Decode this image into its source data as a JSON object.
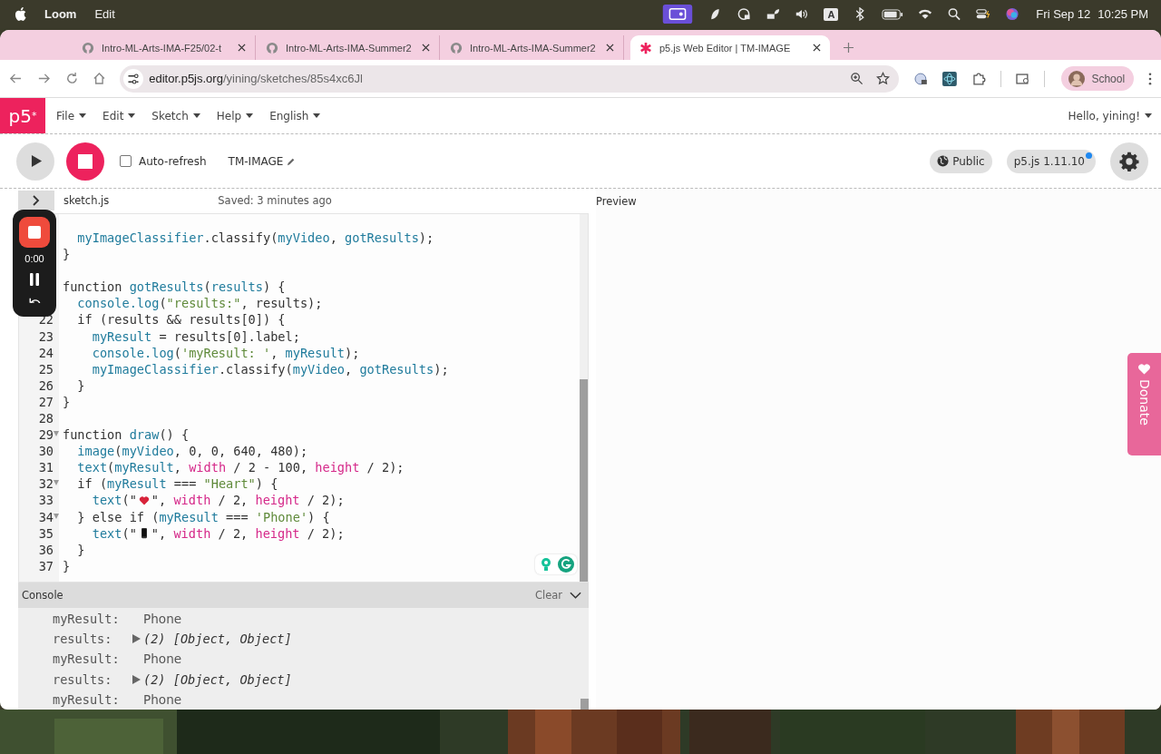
{
  "menubar": {
    "app": "Loom",
    "menus": [
      "Edit"
    ],
    "input_source": "A",
    "date": "Fri Sep 12",
    "time": "10:25 PM"
  },
  "browser": {
    "tabs": [
      {
        "title": "Intro-ML-Arts-IMA-F25/02-t",
        "selected": false
      },
      {
        "title": "Intro-ML-Arts-IMA-Summer2",
        "selected": false
      },
      {
        "title": "Intro-ML-Arts-IMA-Summer2",
        "selected": false
      },
      {
        "title": "p5.js Web Editor | TM-IMAGE",
        "selected": true
      }
    ],
    "address": {
      "host": "editor.p5js.org",
      "path": "/yining/sketches/85s4xc6Jl"
    },
    "profile": "School"
  },
  "nav": {
    "logo": "p5$^{*}$",
    "menus": [
      "File",
      "Edit",
      "Sketch",
      "Help",
      "English"
    ],
    "greeting": "Hello, yining!"
  },
  "toolbar": {
    "auto_refresh": {
      "label": "Auto-refresh",
      "checked": false
    },
    "sketch_name": "TM-IMAGE",
    "visibility": "Public",
    "version": "p5.js 1.11.10",
    "version_update": true
  },
  "recorder": {
    "elapsed": "0:00"
  },
  "editor": {
    "file": "sketch.js",
    "saved": "Saved: 3 minutes ago",
    "lines": [
      {
        "kind": "code",
        "t": [
          {
            "kind": "v",
            "text": "  myImageClassifier"
          },
          {
            "kind": "p",
            "text": ".classify("
          },
          {
            "kind": "v",
            "text": "myVideo"
          },
          {
            "kind": "p",
            "text": ", "
          },
          {
            "kind": "v",
            "text": "gotResults"
          },
          {
            "kind": "p",
            "text": ");"
          }
        ]
      },
      {
        "kind": "code",
        "t": [
          {
            "kind": "p",
            "text": "}"
          }
        ]
      },
      {
        "kind": "blank"
      },
      {
        "kind": "code",
        "t": [
          {
            "kind": "p",
            "text": "function "
          },
          {
            "kind": "v",
            "text": "gotResults"
          },
          {
            "kind": "p",
            "text": "("
          },
          {
            "kind": "v",
            "text": "results"
          },
          {
            "kind": "p",
            "text": ") {"
          }
        ]
      },
      {
        "kind": "code",
        "t": [
          {
            "kind": "v",
            "text": "  console.log"
          },
          {
            "kind": "p",
            "text": "("
          },
          {
            "kind": "s",
            "text": "\"results:\""
          },
          {
            "kind": "p",
            "text": ", results);"
          }
        ]
      },
      {
        "kind": "code",
        "n": "22",
        "fold": false,
        "t": [
          {
            "kind": "p",
            "text": "  if (results && results[0]) {"
          }
        ]
      },
      {
        "kind": "code",
        "n": "23",
        "fold": false,
        "t": [
          {
            "kind": "v",
            "text": "    myResult"
          },
          {
            "kind": "p",
            "text": " = results[0].label;"
          }
        ]
      },
      {
        "kind": "code",
        "n": "24",
        "fold": false,
        "t": [
          {
            "kind": "v",
            "text": "    console.log"
          },
          {
            "kind": "p",
            "text": "("
          },
          {
            "kind": "s",
            "text": "'myResult: '"
          },
          {
            "kind": "p",
            "text": ", "
          },
          {
            "kind": "v",
            "text": "myResult"
          },
          {
            "kind": "p",
            "text": ");"
          }
        ]
      },
      {
        "kind": "code",
        "n": "25",
        "fold": false,
        "t": [
          {
            "kind": "v",
            "text": "    myImageClassifier"
          },
          {
            "kind": "p",
            "text": ".classify("
          },
          {
            "kind": "v",
            "text": "myVideo"
          },
          {
            "kind": "p",
            "text": ", "
          },
          {
            "kind": "v",
            "text": "gotResults"
          },
          {
            "kind": "p",
            "text": ");"
          }
        ]
      },
      {
        "kind": "code",
        "n": "26",
        "fold": false,
        "t": [
          {
            "kind": "p",
            "text": "  }"
          }
        ]
      },
      {
        "kind": "code",
        "n": "27",
        "fold": false,
        "t": [
          {
            "kind": "p",
            "text": "}"
          }
        ]
      },
      {
        "kind": "blank",
        "n": "28",
        "fold": false
      },
      {
        "kind": "code",
        "n": "29",
        "fold": true,
        "t": [
          {
            "kind": "p",
            "text": "function "
          },
          {
            "kind": "v",
            "text": "draw"
          },
          {
            "kind": "p",
            "text": "() {"
          }
        ]
      },
      {
        "kind": "code",
        "n": "30",
        "fold": false,
        "t": [
          {
            "kind": "v",
            "text": "  image"
          },
          {
            "kind": "p",
            "text": "("
          },
          {
            "kind": "v",
            "text": "myVideo"
          },
          {
            "kind": "p",
            "text": ", 0, 0, 640, 480);"
          }
        ]
      },
      {
        "kind": "code",
        "n": "31",
        "fold": false,
        "t": [
          {
            "kind": "v",
            "text": "  text"
          },
          {
            "kind": "p",
            "text": "("
          },
          {
            "kind": "v",
            "text": "myResult"
          },
          {
            "kind": "p",
            "text": ", "
          },
          {
            "kind": "k",
            "text": "width"
          },
          {
            "kind": "p",
            "text": " / 2 - 100, "
          },
          {
            "kind": "k",
            "text": "height"
          },
          {
            "kind": "p",
            "text": " / 2);"
          }
        ]
      },
      {
        "kind": "code",
        "n": "32",
        "fold": true,
        "t": [
          {
            "kind": "p",
            "text": "  if ("
          },
          {
            "kind": "v",
            "text": "myResult"
          },
          {
            "kind": "p",
            "text": " === "
          },
          {
            "kind": "s",
            "text": "\"Heart\""
          },
          {
            "kind": "p",
            "text": ") {"
          }
        ]
      },
      {
        "kind": "code",
        "n": "33",
        "fold": false,
        "t": [
          {
            "kind": "v",
            "text": "    text"
          },
          {
            "kind": "p",
            "text": "(\""
          },
          {
            "kind": "heart"
          },
          {
            "kind": "p",
            "text": "\", "
          },
          {
            "kind": "k",
            "text": "width"
          },
          {
            "kind": "p",
            "text": " / 2, "
          },
          {
            "kind": "k",
            "text": "height"
          },
          {
            "kind": "p",
            "text": " / 2);"
          }
        ]
      },
      {
        "kind": "code",
        "n": "34",
        "fold": true,
        "t": [
          {
            "kind": "p",
            "text": "  } else if ("
          },
          {
            "kind": "v",
            "text": "myResult"
          },
          {
            "kind": "p",
            "text": " === "
          },
          {
            "kind": "s",
            "text": "'Phone'"
          },
          {
            "kind": "p",
            "text": ") {"
          }
        ]
      },
      {
        "kind": "code",
        "n": "35",
        "fold": false,
        "t": [
          {
            "kind": "v",
            "text": "    text"
          },
          {
            "kind": "p",
            "text": "(\""
          },
          {
            "kind": "phone"
          },
          {
            "kind": "p",
            "text": "\", "
          },
          {
            "kind": "k",
            "text": "width"
          },
          {
            "kind": "p",
            "text": " / 2, "
          },
          {
            "kind": "k",
            "text": "height"
          },
          {
            "kind": "p",
            "text": " / 2);"
          }
        ]
      },
      {
        "kind": "code",
        "n": "36",
        "fold": false,
        "t": [
          {
            "kind": "p",
            "text": "  }"
          }
        ]
      },
      {
        "kind": "code",
        "n": "37",
        "fold": false,
        "t": [
          {
            "kind": "p",
            "text": "}"
          }
        ]
      }
    ]
  },
  "preview": {
    "title": "Preview"
  },
  "console": {
    "title": "Console",
    "clear": "Clear",
    "entries": [
      {
        "label": "myResult:",
        "kind": "text",
        "value": "Phone"
      },
      {
        "label": "results:",
        "kind": "object",
        "value": "(2) [Object, Object]"
      },
      {
        "label": "myResult:",
        "kind": "text",
        "value": "Phone"
      },
      {
        "label": "results:",
        "kind": "object",
        "value": "(2) [Object, Object]"
      },
      {
        "label": "myResult:",
        "kind": "text",
        "value": "Phone"
      }
    ]
  },
  "donate": "Donate"
}
